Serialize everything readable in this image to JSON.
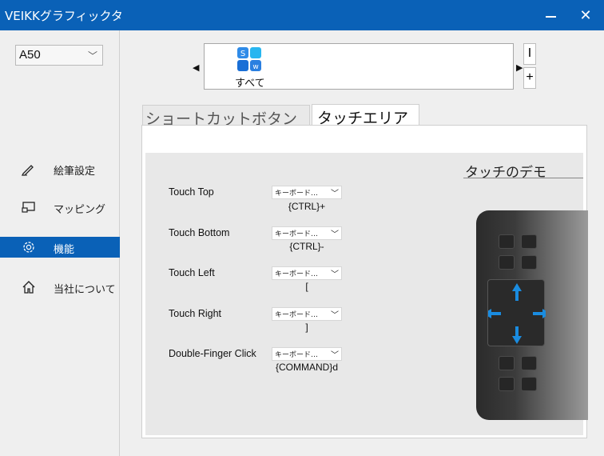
{
  "window": {
    "title": "VEIKKグラフィックタ"
  },
  "sidebar": {
    "device": "A50",
    "items": [
      {
        "label": "絵筆設定",
        "icon": "pen-icon"
      },
      {
        "label": "マッピング",
        "icon": "monitor-icon"
      },
      {
        "label": "機能",
        "icon": "gear-icon",
        "active": true
      },
      {
        "label": "当社について",
        "icon": "home-icon"
      }
    ]
  },
  "functions": {
    "item_label": "すべて",
    "add": "+",
    "remove": "I"
  },
  "tabs": {
    "shortcut": "ショートカットボタン",
    "touch": "タッチエリア"
  },
  "touch": {
    "demo_title": "タッチのデモ",
    "rows": [
      {
        "label": "Touch Top",
        "type": "キーボード…",
        "value": "{CTRL}+"
      },
      {
        "label": "Touch Bottom",
        "type": "キーボード…",
        "value": "{CTRL}-"
      },
      {
        "label": "Touch Left",
        "type": "キーボード…",
        "value": "["
      },
      {
        "label": "Touch Right",
        "type": "キーボード…",
        "value": "]"
      },
      {
        "label": "Double-Finger Click",
        "type": "キーボード…",
        "value": "{COMMAND}d"
      }
    ]
  },
  "colors": {
    "accent": "#0a61b7",
    "arrow": "#1a8ce0"
  }
}
